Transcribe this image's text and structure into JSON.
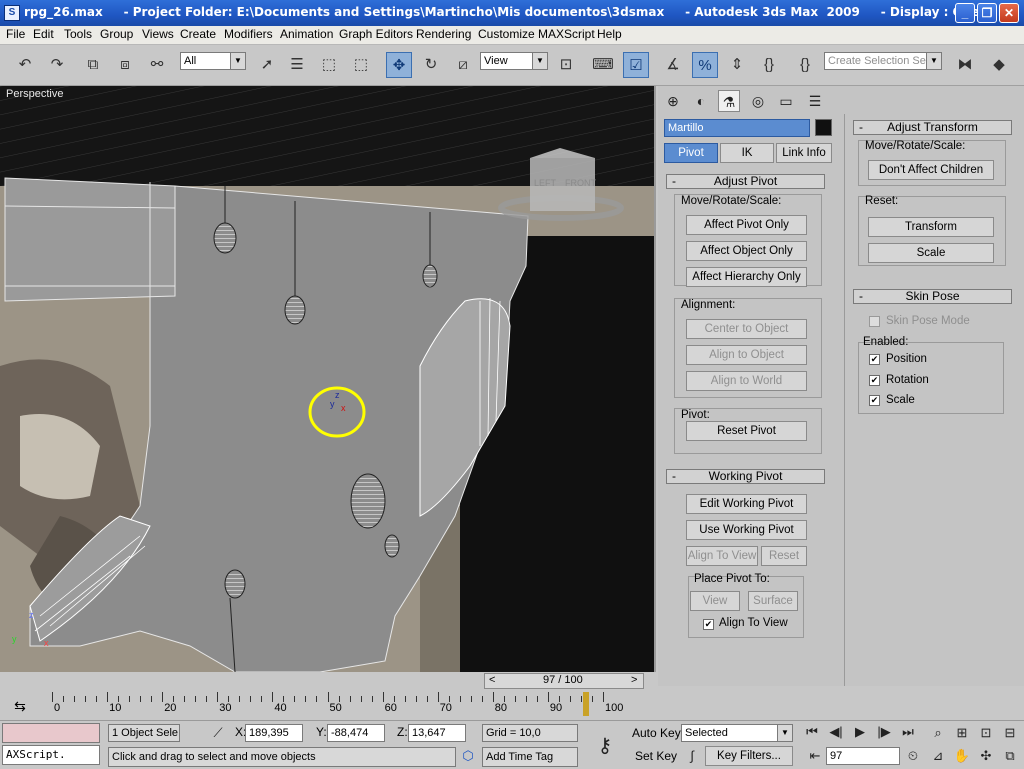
{
  "window": {
    "title": "rpg_26.max     - Project Folder: E:\\Documents and Settings\\Martincho\\Mis documentos\\3dsmax     - Autodesk 3ds Max  2009     - Display : OpenGL",
    "app_icon": "3ds-max-icon",
    "minimize": "_",
    "maximize": "❐",
    "close": "✕"
  },
  "menu": [
    "File",
    "Edit",
    "Tools",
    "Group",
    "Views",
    "Create",
    "Modifiers",
    "Animation",
    "Graph Editors",
    "Rendering",
    "Customize",
    "MAXScript",
    "Help"
  ],
  "toolbar": {
    "selection_filter": "All",
    "reference_coord": "View",
    "named_selection_placeholder": "Create Selection Set",
    "icons": {
      "undo": "↶",
      "redo": "↷",
      "link": "⧉",
      "unlink": "⧈",
      "bind": "⚯",
      "select": "➚",
      "select_by_name": "☰",
      "rect_region": "⬚",
      "window_crossing": "⬚",
      "move": "✥",
      "rotate": "↻",
      "scale": "⧄",
      "pivot": "⊡",
      "keyboard": "⌨",
      "snap": "☑",
      "angle_snap": "∡",
      "percent_snap": "%",
      "spinner_snap": "⇕",
      "edit_named_sel": "{}",
      "mirror": "⧓",
      "align": "◆"
    }
  },
  "viewport": {
    "label": "Perspective",
    "viewcube_left": "LEFT",
    "viewcube_front": "FRONT",
    "gizmo_x": "x",
    "gizmo_y": "y",
    "gizmo_z": "z"
  },
  "command_panel": {
    "object_name": "Martillo",
    "object_color": "#101010",
    "tabs": [
      "create",
      "modify",
      "hierarchy",
      "motion",
      "display",
      "utilities"
    ],
    "subtabs": [
      "Pivot",
      "IK",
      "Link Info"
    ],
    "adjust_pivot": {
      "header": "Adjust Pivot",
      "move_rotate_scale": "Move/Rotate/Scale:",
      "affect_pivot_only": "Affect Pivot Only",
      "affect_object_only": "Affect Object Only",
      "affect_hierarchy_only": "Affect Hierarchy Only",
      "alignment": "Alignment:",
      "center_to_object": "Center to Object",
      "align_to_object": "Align to Object",
      "align_to_world": "Align to World",
      "pivot": "Pivot:",
      "reset_pivot": "Reset Pivot"
    },
    "working_pivot": {
      "header": "Working Pivot",
      "edit_working_pivot": "Edit Working Pivot",
      "use_working_pivot": "Use Working Pivot",
      "align_to_view": "Align To View",
      "reset": "Reset",
      "place_pivot_to": "Place Pivot To:",
      "view": "View",
      "surface": "Surface",
      "align_to_view_check": "Align To View"
    },
    "adjust_transform": {
      "header": "Adjust Transform",
      "move_rotate_scale": "Move/Rotate/Scale:",
      "dont_affect_children": "Don't Affect Children",
      "reset": "Reset:",
      "transform": "Transform",
      "scale": "Scale"
    },
    "skin_pose": {
      "header": "Skin Pose",
      "skin_pose_mode": "Skin Pose Mode",
      "enabled": "Enabled:",
      "position": "Position",
      "rotation": "Rotation",
      "scale": "Scale"
    }
  },
  "timeline": {
    "frame_display": "97 / 100",
    "prev": "<",
    "next": ">",
    "ticks": [
      0,
      10,
      20,
      30,
      40,
      50,
      60,
      70,
      80,
      90,
      100
    ],
    "current_frame": 97,
    "max_frame": 100
  },
  "status": {
    "maxscript_listener": "AXScript.",
    "object_count": "1 Object Sele",
    "x_label": "X:",
    "x_value": "189,395",
    "y_label": "Y:",
    "y_value": "-88,474",
    "z_label": "Z:",
    "z_value": "13,647",
    "grid": "Grid = 10,0",
    "prompt": "Click and drag to select and move objects",
    "add_time_tag": "Add Time Tag",
    "auto_key": "Auto Key",
    "set_key": "Set Key",
    "key_mode": "Selected",
    "key_filters": "Key Filters...",
    "frame": "97"
  },
  "colors": {
    "titlebar": "#1f56c2",
    "accent": "#5b8cd0",
    "highlight_circle": "#ffff00",
    "listener_pink": "#e8c8cc"
  }
}
